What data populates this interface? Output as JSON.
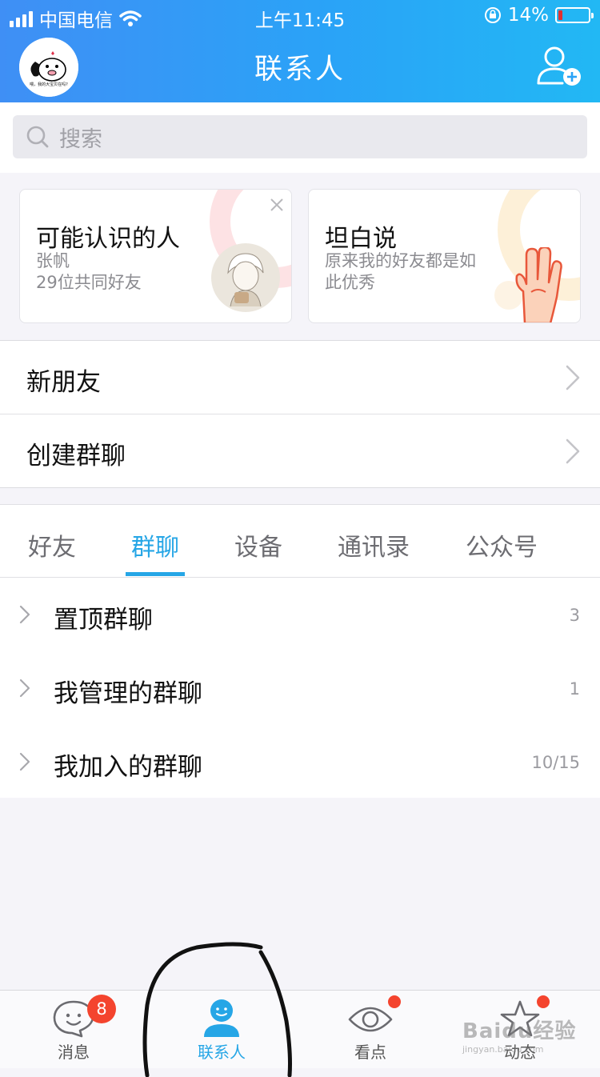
{
  "status_bar": {
    "carrier": "中国电信",
    "time": "上午11:45",
    "battery_percent": "14%",
    "battery_level": 0.14
  },
  "nav": {
    "title": "联系人",
    "avatar_caption": "喂，我的大宝贝在吗?",
    "add_icon": "add-friend-icon"
  },
  "search": {
    "placeholder": "搜索",
    "icon": "search-icon"
  },
  "cards": [
    {
      "title": "可能认识的人",
      "line1": "张帆",
      "line2": "29位共同好友"
    },
    {
      "title": "坦白说",
      "line1": "原来我的好友都是如",
      "line2": "此优秀"
    }
  ],
  "rows": [
    {
      "label": "新朋友"
    },
    {
      "label": "创建群聊"
    }
  ],
  "tabs": [
    "好友",
    "群聊",
    "设备",
    "通讯录",
    "公众号"
  ],
  "active_tab": "群聊",
  "groups": [
    {
      "name": "置顶群聊",
      "count": "3"
    },
    {
      "name": "我管理的群聊",
      "count": "1"
    },
    {
      "name": "我加入的群聊",
      "count": "10/15"
    }
  ],
  "tabbar": {
    "items": [
      {
        "label": "消息",
        "icon": "message-icon",
        "badge": "8"
      },
      {
        "label": "联系人",
        "icon": "contacts-icon",
        "active": true
      },
      {
        "label": "看点",
        "icon": "eye-icon",
        "dot": true
      },
      {
        "label": "动态",
        "icon": "star-icon",
        "dot": true
      }
    ]
  },
  "watermark": {
    "brand": "Baidu经验",
    "url": "jingyan.baidu.com"
  },
  "colors": {
    "accent": "#26a6e6",
    "header_start": "#3f8ff5",
    "header_end": "#22b8f4",
    "badge": "#f4442e"
  }
}
